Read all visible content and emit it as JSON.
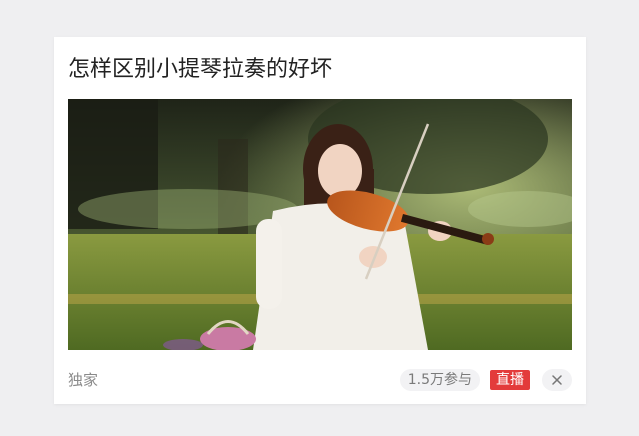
{
  "card": {
    "title": "怎样区别小提琴拉奏的好坏",
    "source": "独家",
    "participants": "1.5万参与",
    "live_label": "直播",
    "close_icon": "close-icon",
    "image_subject": "violin-player-photo"
  },
  "colors": {
    "page_bg": "#efeff1",
    "card_bg": "#ffffff",
    "live_badge": "#e33b3b",
    "muted_text": "#8a8a8a"
  }
}
